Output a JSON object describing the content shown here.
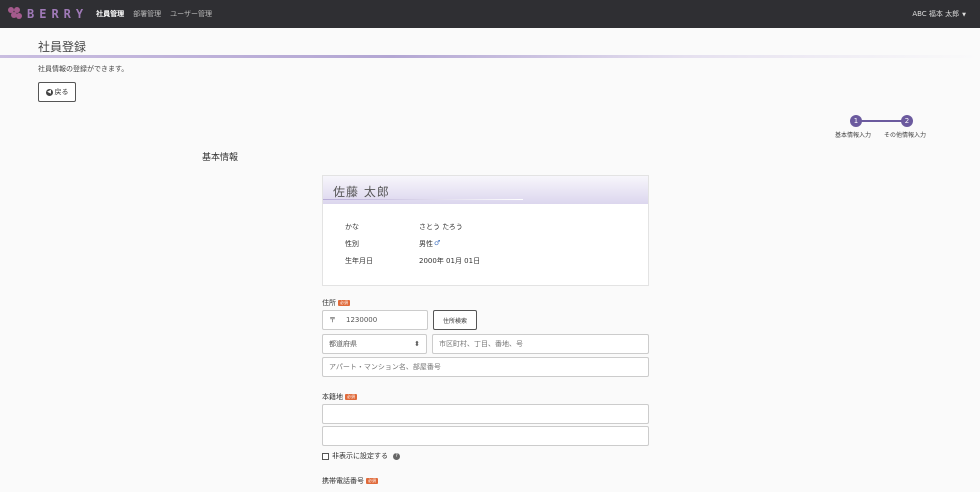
{
  "app": {
    "logo_text": "BERRY"
  },
  "nav": {
    "items": [
      "社員管理",
      "部署管理",
      "ユーザー管理"
    ],
    "active_index": 0
  },
  "user_menu": {
    "label": "ABC 福本 太郎"
  },
  "page": {
    "title": "社員登録",
    "description": "社員情報の登録ができます。",
    "back_label": "戻る"
  },
  "stepper": {
    "steps": [
      {
        "number": "1",
        "label": "基本情報入力"
      },
      {
        "number": "2",
        "label": "その他情報入力"
      }
    ],
    "current": 2
  },
  "section": {
    "title": "基本情報"
  },
  "profile": {
    "name": "佐藤 太郎",
    "kana_label": "かな",
    "kana_value": "さとう たろう",
    "gender_label": "性別",
    "gender_value": "男性",
    "birth_label": "生年月日",
    "birth_value": "2000年 01月 01日"
  },
  "address": {
    "label": "住所",
    "required_badge": "必須",
    "postal_prefix": "〒",
    "postal_value": "1230000",
    "search_button": "住所検索",
    "prefecture_placeholder": "都道府県",
    "city_placeholder": "市区町村、丁目、番地、号",
    "building_placeholder": "アパート・マンション名、部屋番号"
  },
  "registered_domicile": {
    "label": "本籍地",
    "required_badge": "必須"
  },
  "hide_option": {
    "label": "非表示に設定する"
  },
  "mobile": {
    "label": "携帯電話番号",
    "required_badge": "必須"
  },
  "colors": {
    "topbar": "#2f2f33",
    "accent": "#6b5a9e",
    "required": "#e06a3a"
  }
}
